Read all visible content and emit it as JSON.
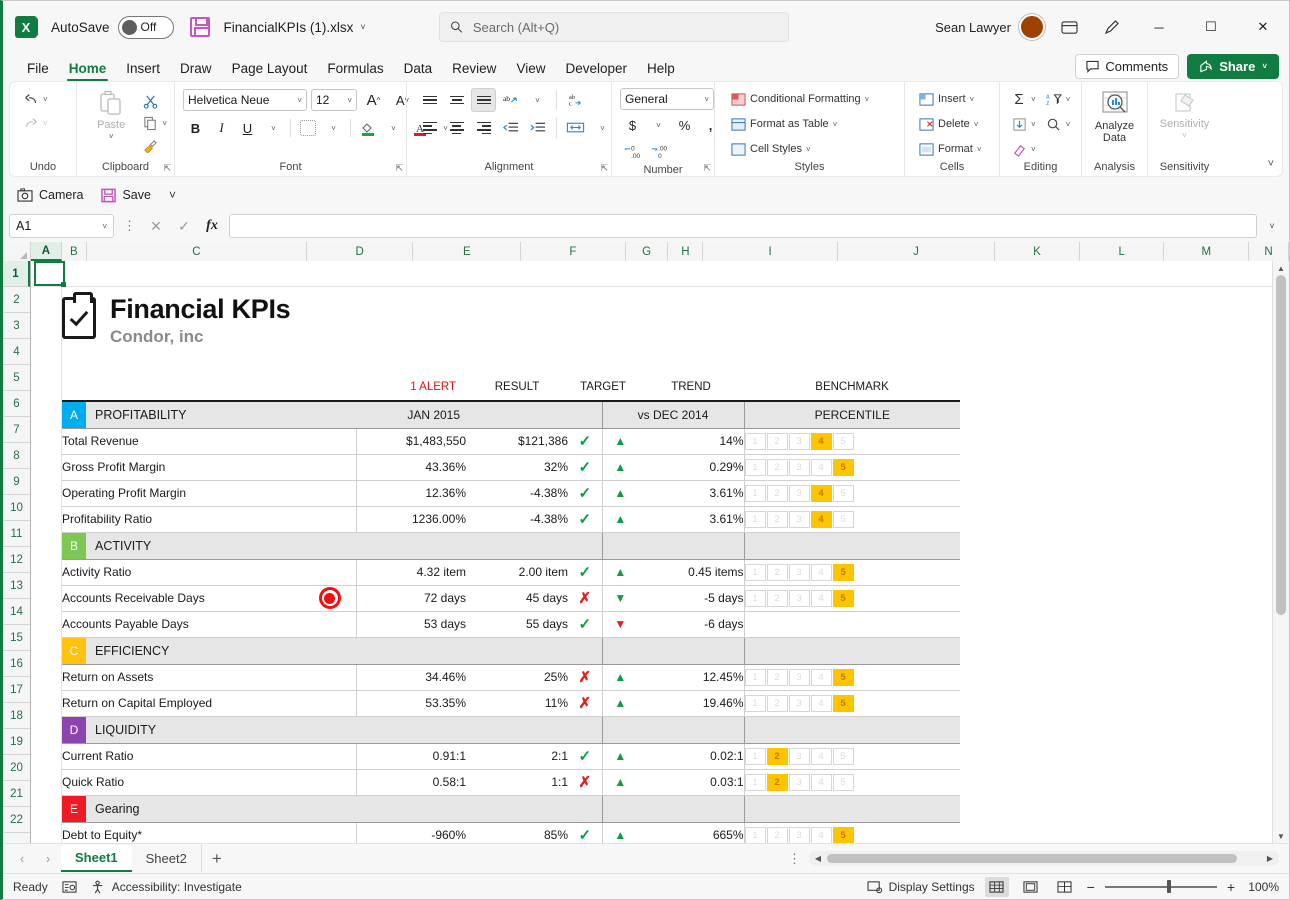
{
  "titlebar": {
    "app_icon": "excel-logo",
    "autosave_label": "AutoSave",
    "autosave_state": "Off",
    "save_icon": "save-icon",
    "filename": "FinancialKPIs (1).xlsx",
    "filename_caret": "˅",
    "search_placeholder": "Search (Alt+Q)",
    "search_value": "",
    "search_icon": "search-icon",
    "username": "Sean Lawyer",
    "ribbon_display_icon": "ribbon-display-options-icon",
    "pen_icon": "pen-icon",
    "minimize": "─",
    "maximize": "☐",
    "close": "✕"
  },
  "ribbon_tabs": [
    {
      "label": "File",
      "active": false
    },
    {
      "label": "Home",
      "active": true
    },
    {
      "label": "Insert",
      "active": false
    },
    {
      "label": "Draw",
      "active": false
    },
    {
      "label": "Page Layout",
      "active": false
    },
    {
      "label": "Formulas",
      "active": false
    },
    {
      "label": "Data",
      "active": false
    },
    {
      "label": "Review",
      "active": false
    },
    {
      "label": "View",
      "active": false
    },
    {
      "label": "Developer",
      "active": false
    },
    {
      "label": "Help",
      "active": false
    }
  ],
  "ribbon_right": {
    "comments_label": "Comments",
    "share_label": "Share",
    "share_caret": "˅",
    "collapse_caret": "˅"
  },
  "ribbon": {
    "groups": [
      {
        "name": "Undo",
        "label": "Undo"
      },
      {
        "name": "Clipboard",
        "label": "Clipboard",
        "paste_label": "Paste"
      },
      {
        "name": "Font",
        "label": "Font",
        "font_name": "Helvetica Neue",
        "font_size": "12",
        "grow_label": "A",
        "shrink_label": "A",
        "bold": "B",
        "italic": "I",
        "underline": "U"
      },
      {
        "name": "Alignment",
        "label": "Alignment"
      },
      {
        "name": "Number",
        "label": "Number",
        "format": "General",
        "currency": "$",
        "percent": "%",
        "comma": ",",
        "inc_dec": ".00",
        "dec_dec": ".00"
      },
      {
        "name": "Styles",
        "label": "Styles",
        "items": [
          "Conditional Formatting",
          "Format as Table",
          "Cell Styles"
        ]
      },
      {
        "name": "Cells",
        "label": "Cells",
        "items": [
          "Insert",
          "Delete",
          "Format"
        ]
      },
      {
        "name": "Editing",
        "label": "Editing"
      },
      {
        "name": "Analysis",
        "label": "Analysis",
        "button": "Analyze Data"
      },
      {
        "name": "Sensitivity",
        "label": "Sensitivity",
        "button": "Sensitivity"
      }
    ]
  },
  "quick_access": {
    "camera_label": "Camera",
    "save_label": "Save",
    "overflow_caret": "˅"
  },
  "formula_bar": {
    "name_box": "A1",
    "name_box_caret": "˅",
    "cancel_icon": "✕",
    "confirm_icon": "✓",
    "fx_icon": "fx",
    "formula_value": "",
    "expand_caret": "˅"
  },
  "grid": {
    "columns": [
      "A",
      "B",
      "C",
      "D",
      "E",
      "F",
      "G",
      "H",
      "I",
      "J",
      "K",
      "L",
      "M",
      "N"
    ],
    "rows": [
      1,
      2,
      3,
      4,
      5,
      6,
      7,
      8,
      9,
      10,
      11,
      12,
      13,
      14,
      15,
      16,
      17,
      18,
      19,
      20,
      21,
      22
    ],
    "selected_cell": "A1",
    "selected_column": "A",
    "selected_row": 1
  },
  "dashboard": {
    "title": "Financial KPIs",
    "subtitle": "Condor, inc",
    "logo_icon": "clipboard-check-icon",
    "headers": {
      "alert": "1 ALERT",
      "result": "RESULT",
      "target": "TARGET",
      "trend": "TREND",
      "benchmark": "BENCHMARK"
    },
    "sections": [
      {
        "badge": "A",
        "name": "PROFITABILITY",
        "badge_color": "#00aeef",
        "period_result": "JAN 2015",
        "period_trend": "vs DEC 2014",
        "period_benchmark": "PERCENTILE",
        "rows": [
          {
            "name": "Total Revenue",
            "alert": false,
            "result": "$1,483,550",
            "target": "$121,386",
            "flag": "tick",
            "arrow": "up-green",
            "delta": "14%",
            "percentile": 4
          },
          {
            "name": "Gross Profit Margin",
            "alert": false,
            "result": "43.36%",
            "target": "32%",
            "flag": "tick",
            "arrow": "up-green",
            "delta": "0.29%",
            "percentile": 5
          },
          {
            "name": "Operating Profit Margin",
            "alert": false,
            "result": "12.36%",
            "target": "-4.38%",
            "flag": "tick",
            "arrow": "up-green",
            "delta": "3.61%",
            "percentile": 4
          },
          {
            "name": "Profitability Ratio",
            "alert": false,
            "result": "1236.00%",
            "target": "-4.38%",
            "flag": "tick",
            "arrow": "up-green",
            "delta": "3.61%",
            "percentile": 4
          }
        ]
      },
      {
        "badge": "B",
        "name": "ACTIVITY",
        "badge_color": "#7dc855",
        "period_result": "",
        "period_trend": "",
        "period_benchmark": "",
        "rows": [
          {
            "name": "Activity Ratio",
            "alert": false,
            "result": "4.32 item",
            "target": "2.00 item",
            "flag": "tick",
            "arrow": "up-green",
            "delta": "0.45 items",
            "percentile": 5
          },
          {
            "name": "Accounts Receivable Days",
            "alert": true,
            "result": "72 days",
            "target": "45 days",
            "flag": "cross",
            "arrow": "down-green",
            "delta": "-5 days",
            "percentile": 5
          },
          {
            "name": "Accounts Payable Days",
            "alert": false,
            "result": "53 days",
            "target": "55 days",
            "flag": "tick",
            "arrow": "down-red",
            "delta": "-6 days",
            "percentile": 0
          }
        ]
      },
      {
        "badge": "C",
        "name": "EFFICIENCY",
        "badge_color": "#ffc20e",
        "period_result": "",
        "period_trend": "",
        "period_benchmark": "",
        "rows": [
          {
            "name": "Return on Assets",
            "alert": false,
            "result": "34.46%",
            "target": "25%",
            "flag": "cross",
            "arrow": "up-green",
            "delta": "12.45%",
            "percentile": 5
          },
          {
            "name": "Return on Capital Employed",
            "alert": false,
            "result": "53.35%",
            "target": "11%",
            "flag": "cross",
            "arrow": "up-green",
            "delta": "19.46%",
            "percentile": 5
          }
        ]
      },
      {
        "badge": "D",
        "name": "LIQUIDITY",
        "badge_color": "#8e44ad",
        "period_result": "",
        "period_trend": "",
        "period_benchmark": "",
        "rows": [
          {
            "name": "Current Ratio",
            "alert": false,
            "result": "0.91:1",
            "target": "2:1",
            "flag": "tick",
            "arrow": "up-green",
            "delta": "0.02:1",
            "percentile": 2
          },
          {
            "name": "Quick Ratio",
            "alert": false,
            "result": "0.58:1",
            "target": "1:1",
            "flag": "cross",
            "arrow": "up-green",
            "delta": "0.03:1",
            "percentile": 2
          }
        ]
      },
      {
        "badge": "E",
        "name": "Gearing",
        "badge_color": "#ed1c24",
        "period_result": "",
        "period_trend": "",
        "period_benchmark": "",
        "rows": [
          {
            "name": "Debt to Equity*",
            "alert": false,
            "result": "-960%",
            "target": "85%",
            "flag": "tick",
            "arrow": "up-green",
            "delta": "665%",
            "percentile": 5
          }
        ]
      }
    ],
    "percentile_labels": [
      "1",
      "2",
      "3",
      "4",
      "5"
    ]
  },
  "sheet_tabs": {
    "prev_icon": "‹",
    "next_icon": "›",
    "tabs": [
      {
        "label": "Sheet1",
        "active": true
      },
      {
        "label": "Sheet2",
        "active": false
      }
    ],
    "add_label": "+",
    "overflow": "⋮"
  },
  "statusbar": {
    "state": "Ready",
    "macro_icon": "record-macro-icon",
    "accessibility": "Accessibility: Investigate",
    "display_settings": "Display Settings",
    "view_normal_icon": "normal-view-icon",
    "view_layout_icon": "page-layout-view-icon",
    "view_break_icon": "page-break-view-icon",
    "zoom_out": "−",
    "zoom_in": "+",
    "zoom_level": "100%"
  }
}
